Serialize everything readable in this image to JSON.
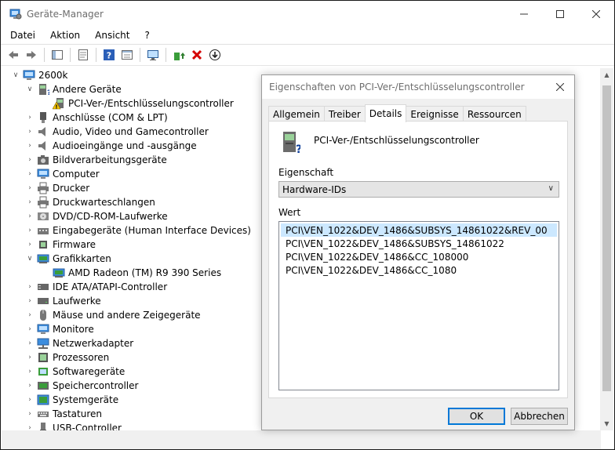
{
  "window": {
    "title": "Geräte-Manager"
  },
  "menu": [
    "Datei",
    "Aktion",
    "Ansicht",
    "?"
  ],
  "tree": [
    {
      "label": "2600k",
      "level": 0,
      "state": "expanded",
      "icon": "computer-root-icon"
    },
    {
      "label": "Andere Geräte",
      "level": 1,
      "state": "expanded",
      "icon": "unknown-device-icon"
    },
    {
      "label": "PCI-Ver-/Entschlüsselungscontroller",
      "level": 2,
      "state": "leaf",
      "icon": "warning-device-icon"
    },
    {
      "label": "Anschlüsse (COM & LPT)",
      "level": 1,
      "state": "collapsed",
      "icon": "port-icon"
    },
    {
      "label": "Audio, Video und Gamecontroller",
      "level": 1,
      "state": "collapsed",
      "icon": "speaker-icon"
    },
    {
      "label": "Audioeingänge und -ausgänge",
      "level": 1,
      "state": "collapsed",
      "icon": "speaker-icon"
    },
    {
      "label": "Bildverarbeitungsgeräte",
      "level": 1,
      "state": "collapsed",
      "icon": "camera-icon"
    },
    {
      "label": "Computer",
      "level": 1,
      "state": "collapsed",
      "icon": "monitor-icon"
    },
    {
      "label": "Drucker",
      "level": 1,
      "state": "collapsed",
      "icon": "printer-icon"
    },
    {
      "label": "Druckwarteschlangen",
      "level": 1,
      "state": "collapsed",
      "icon": "printer-icon"
    },
    {
      "label": "DVD/CD-ROM-Laufwerke",
      "level": 1,
      "state": "collapsed",
      "icon": "disc-icon"
    },
    {
      "label": "Eingabegeräte (Human Interface Devices)",
      "level": 1,
      "state": "collapsed",
      "icon": "hid-icon"
    },
    {
      "label": "Firmware",
      "level": 1,
      "state": "collapsed",
      "icon": "chip-icon"
    },
    {
      "label": "Grafikkarten",
      "level": 1,
      "state": "expanded",
      "icon": "display-adapter-icon"
    },
    {
      "label": "AMD Radeon (TM) R9 390 Series",
      "level": 2,
      "state": "leaf",
      "icon": "display-adapter-icon"
    },
    {
      "label": "IDE ATA/ATAPI-Controller",
      "level": 1,
      "state": "collapsed",
      "icon": "drive-controller-icon"
    },
    {
      "label": "Laufwerke",
      "level": 1,
      "state": "collapsed",
      "icon": "drive-icon"
    },
    {
      "label": "Mäuse und andere Zeigegeräte",
      "level": 1,
      "state": "collapsed",
      "icon": "mouse-icon"
    },
    {
      "label": "Monitore",
      "level": 1,
      "state": "collapsed",
      "icon": "monitor-icon"
    },
    {
      "label": "Netzwerkadapter",
      "level": 1,
      "state": "collapsed",
      "icon": "network-icon"
    },
    {
      "label": "Prozessoren",
      "level": 1,
      "state": "collapsed",
      "icon": "cpu-icon"
    },
    {
      "label": "Softwaregeräte",
      "level": 1,
      "state": "collapsed",
      "icon": "software-device-icon"
    },
    {
      "label": "Speichercontroller",
      "level": 1,
      "state": "collapsed",
      "icon": "storage-controller-icon"
    },
    {
      "label": "Systemgeräte",
      "level": 1,
      "state": "collapsed",
      "icon": "system-device-icon"
    },
    {
      "label": "Tastaturen",
      "level": 1,
      "state": "collapsed",
      "icon": "keyboard-icon"
    },
    {
      "label": "USB-Controller",
      "level": 1,
      "state": "collapsed",
      "icon": "usb-icon"
    }
  ],
  "dialog": {
    "title": "Eigenschaften von PCI-Ver-/Entschlüsselungscontroller",
    "tabs": [
      "Allgemein",
      "Treiber",
      "Details",
      "Ereignisse",
      "Ressourcen"
    ],
    "active_tab": "Details",
    "device_name": "PCI-Ver-/Entschlüsselungscontroller",
    "property_label": "Eigenschaft",
    "property_value": "Hardware-IDs",
    "value_label": "Wert",
    "values": [
      "PCI\\VEN_1022&DEV_1486&SUBSYS_14861022&REV_00",
      "PCI\\VEN_1022&DEV_1486&SUBSYS_14861022",
      "PCI\\VEN_1022&DEV_1486&CC_108000",
      "PCI\\VEN_1022&DEV_1486&CC_1080"
    ],
    "selected_value_index": 0,
    "ok_label": "OK",
    "cancel_label": "Abbrechen"
  },
  "colors": {
    "selection": "#cce8ff",
    "focus_border": "#0078d7",
    "error_red": "#d40000",
    "warning_yellow": "#f5c400"
  }
}
